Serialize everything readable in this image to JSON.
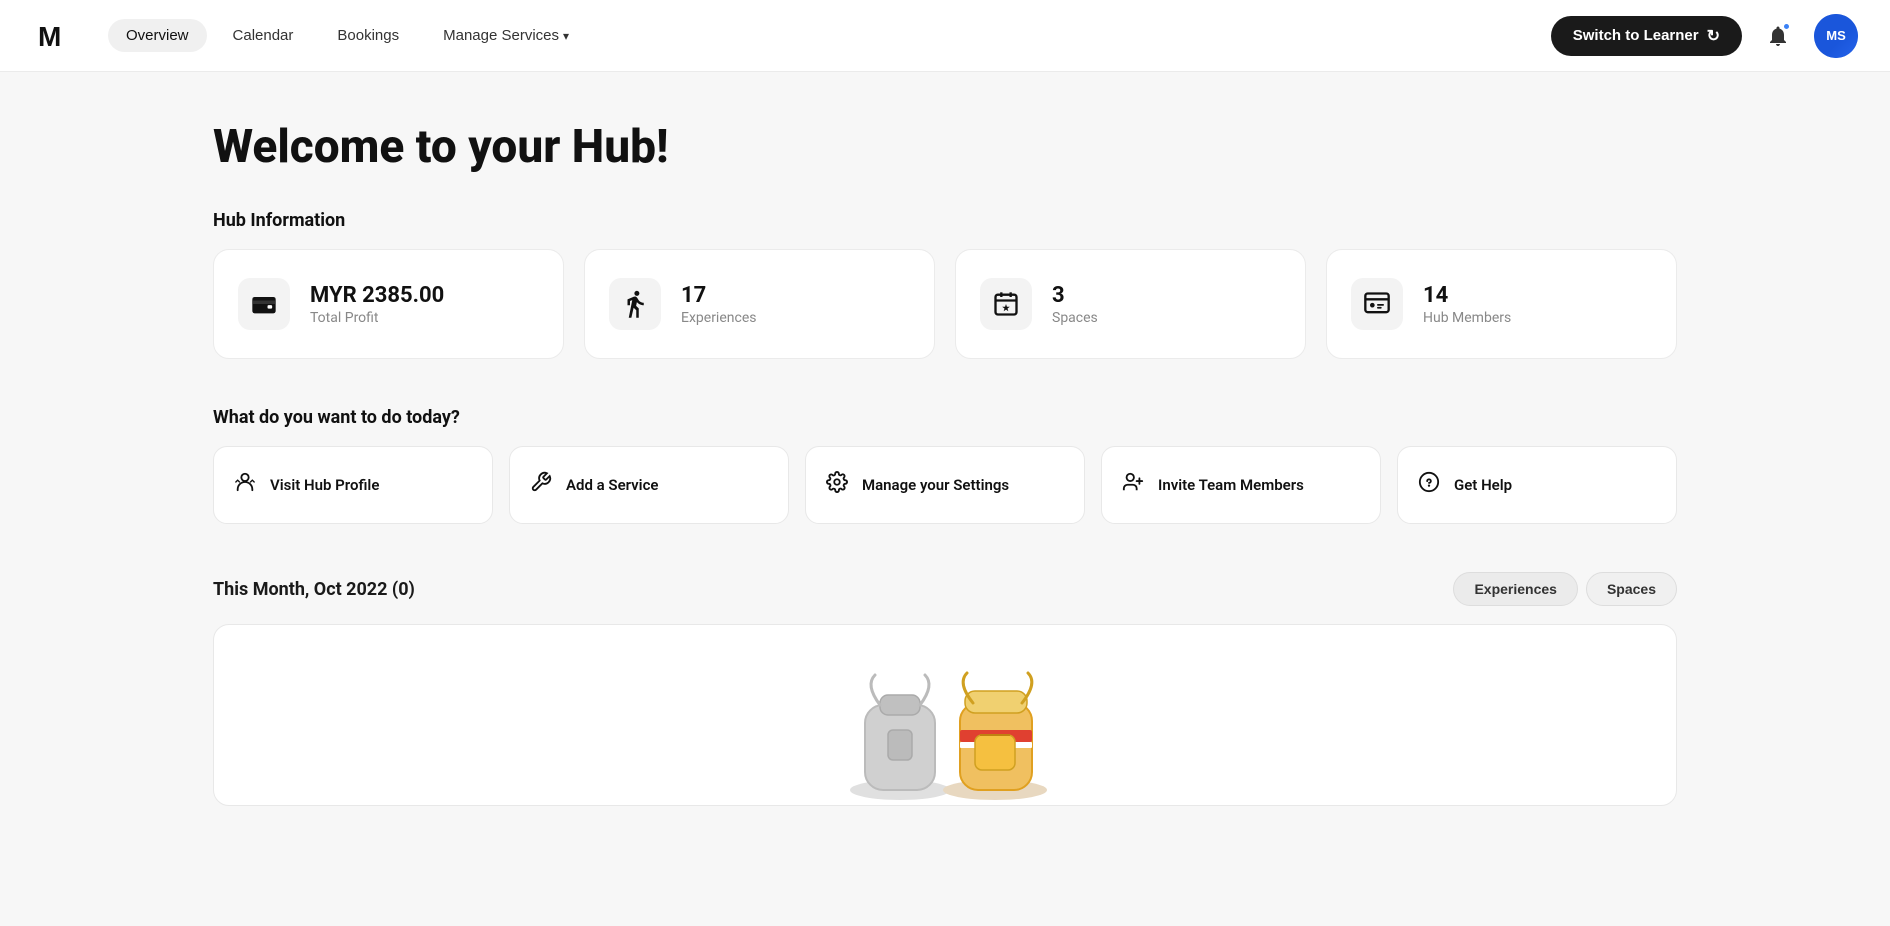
{
  "nav": {
    "logo_alt": "Mentorspace Logo",
    "links": [
      {
        "id": "overview",
        "label": "Overview",
        "active": true
      },
      {
        "id": "calendar",
        "label": "Calendar",
        "active": false
      },
      {
        "id": "bookings",
        "label": "Bookings",
        "active": false
      },
      {
        "id": "manage-services",
        "label": "Manage Services",
        "active": false,
        "dropdown": true
      }
    ],
    "switch_learner_label": "Switch to Learner",
    "avatar_label": "MS"
  },
  "page": {
    "welcome_title": "Welcome to your Hub!",
    "hub_info_label": "Hub Information"
  },
  "stats": [
    {
      "id": "profit",
      "icon": "wallet",
      "value": "MYR 2385.00",
      "label": "Total Profit"
    },
    {
      "id": "experiences",
      "icon": "experiences",
      "value": "17",
      "label": "Experiences"
    },
    {
      "id": "spaces",
      "icon": "spaces",
      "value": "3",
      "label": "Spaces"
    },
    {
      "id": "hub-members",
      "icon": "members",
      "value": "14",
      "label": "Hub Members"
    }
  ],
  "actions": {
    "section_title": "What do you want to do today?",
    "items": [
      {
        "id": "visit-hub-profile",
        "icon": "✳",
        "label": "Visit Hub Profile"
      },
      {
        "id": "add-service",
        "icon": "✦",
        "label": "Add a Service"
      },
      {
        "id": "manage-settings",
        "icon": "⚙",
        "label": "Manage your Settings"
      },
      {
        "id": "invite-team",
        "icon": "👤",
        "label": "Invite Team Members"
      },
      {
        "id": "get-help",
        "icon": "ℹ",
        "label": "Get Help"
      }
    ]
  },
  "monthly": {
    "title": "This Month, Oct 2022 (0)",
    "tabs": [
      {
        "id": "experiences",
        "label": "Experiences",
        "active": true
      },
      {
        "id": "spaces",
        "label": "Spaces",
        "active": false
      }
    ]
  }
}
